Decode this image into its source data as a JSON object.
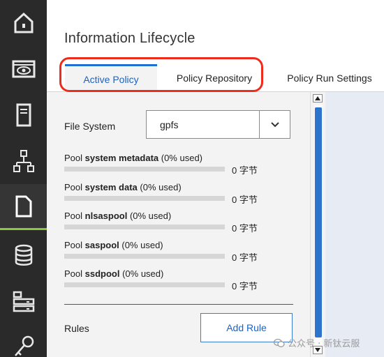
{
  "nav": {
    "items": [
      {
        "icon": "home-icon",
        "active": false
      },
      {
        "icon": "monitor-eye-icon",
        "active": false
      },
      {
        "icon": "server-icon",
        "active": false
      },
      {
        "icon": "network-icon",
        "active": false
      },
      {
        "icon": "file-icon",
        "active": true
      },
      {
        "icon": "database-icon",
        "active": false
      },
      {
        "icon": "storage-rack-icon",
        "active": false
      },
      {
        "icon": "key-icon",
        "active": false
      }
    ],
    "active_color": "#8cc63f"
  },
  "page": {
    "title": "Information Lifecycle"
  },
  "tabs": [
    {
      "label": "Active Policy",
      "active": true
    },
    {
      "label": "Policy Repository",
      "active": false
    },
    {
      "label": "Policy Run Settings",
      "active": false
    }
  ],
  "file_system": {
    "label": "File System",
    "value": "gpfs"
  },
  "pools": [
    {
      "prefix": "Pool ",
      "name": "system metadata",
      "usage": " (0% used)",
      "size": "0 字节",
      "used_fraction": 0
    },
    {
      "prefix": "Pool ",
      "name": "system data",
      "usage": " (0% used)",
      "size": "0 字节",
      "used_fraction": 0
    },
    {
      "prefix": "Pool ",
      "name": "nlsaspool",
      "usage": " (0% used)",
      "size": "0 字节",
      "used_fraction": 0
    },
    {
      "prefix": "Pool ",
      "name": "saspool",
      "usage": " (0% used)",
      "size": "0 字节",
      "used_fraction": 0
    },
    {
      "prefix": "Pool ",
      "name": "ssdpool",
      "usage": " (0% used)",
      "size": "0 字节",
      "used_fraction": 0
    }
  ],
  "rules": {
    "label": "Rules",
    "add_button": "Add Rule"
  },
  "watermark": {
    "text": "公众号 · 新钛云服"
  },
  "colors": {
    "accent": "#1b62c3",
    "highlight": "#ee2b1c",
    "nav_bg": "#2a2a2a"
  }
}
